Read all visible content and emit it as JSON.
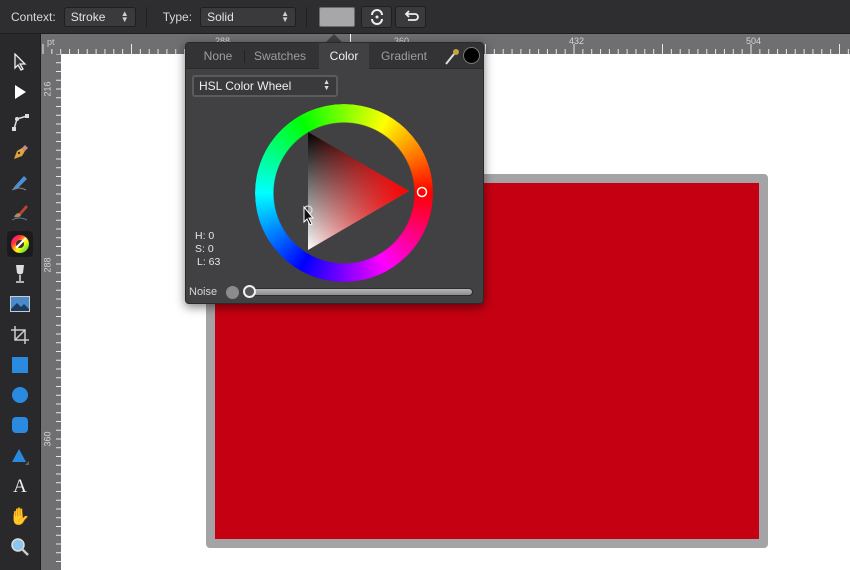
{
  "toolbar": {
    "context_label": "Context:",
    "context_value": "Stroke",
    "type_label": "Type:",
    "type_value": "Solid",
    "stroke_swatch_color": "#a7a6a8",
    "swap_button_icon": "swap-icon",
    "reverse_button_icon": "reverse-icon"
  },
  "rulers": {
    "unit": "pt",
    "top_labels": [
      "288",
      "360",
      "432",
      "504"
    ],
    "left_labels": [
      "216",
      "288",
      "360"
    ]
  },
  "tools": [
    {
      "name": "move-tool",
      "icon": "arrow-pointer-icon"
    },
    {
      "name": "node-tool",
      "icon": "node-select-icon"
    },
    {
      "name": "corner-tool",
      "icon": "corner-icon"
    },
    {
      "name": "pen-tool",
      "icon": "pen-nib-icon"
    },
    {
      "name": "pencil-tool",
      "icon": "pencil-icon"
    },
    {
      "name": "vector-brush-tool",
      "icon": "brush-icon"
    },
    {
      "name": "fill-tool",
      "icon": "color-wheel-icon",
      "active": true
    },
    {
      "name": "transparency-tool",
      "icon": "wine-glass-icon"
    },
    {
      "name": "place-image-tool",
      "icon": "image-icon"
    },
    {
      "name": "crop-tool",
      "icon": "crop-icon"
    },
    {
      "name": "rectangle-tool",
      "icon": "square-icon"
    },
    {
      "name": "ellipse-tool",
      "icon": "circle-icon"
    },
    {
      "name": "rounded-rectangle-tool",
      "icon": "rounded-square-icon"
    },
    {
      "name": "triangle-tool",
      "icon": "triangle-icon"
    },
    {
      "name": "artistic-text-tool",
      "icon": "text-icon"
    },
    {
      "name": "view-tool",
      "icon": "hand-icon"
    },
    {
      "name": "zoom-tool",
      "icon": "magnifier-icon"
    }
  ],
  "color_popover": {
    "tabs": [
      "None",
      "Swatches",
      "Color",
      "Gradient"
    ],
    "active_tab": "Color",
    "picker_icon": "eyedropper-icon",
    "current_color": "#000000",
    "mode": "HSL Color Wheel",
    "hsl": {
      "h_label": "H: 0",
      "s_label": "S: 0",
      "l_label": "L: 63"
    },
    "noise_label": "Noise",
    "noise_value": 0
  },
  "canvas": {
    "shape_fill": "#c50012",
    "shape_stroke": "#a4a3a5"
  }
}
